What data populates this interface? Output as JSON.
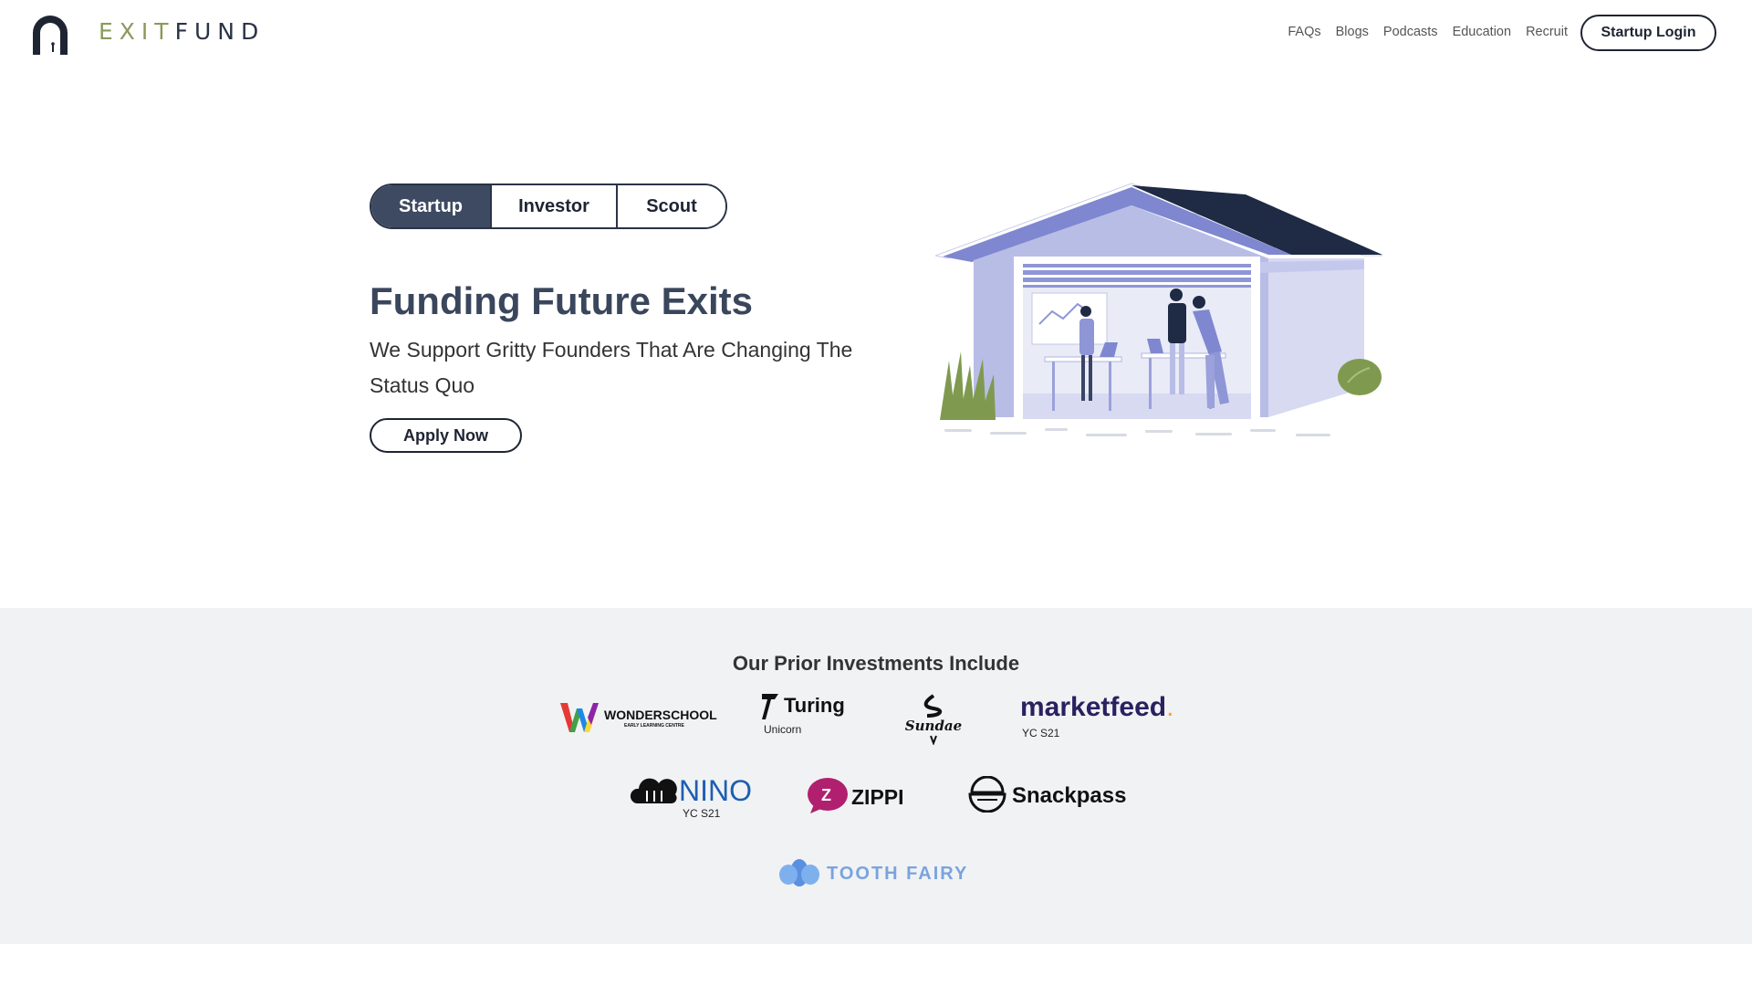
{
  "brand": {
    "name_part1": "EXIT",
    "name_part2": "FUND",
    "mark_icon": "arch-keyhole-icon"
  },
  "nav": {
    "items": [
      "FAQs",
      "Blogs",
      "Podcasts",
      "Education",
      "Recruit"
    ],
    "login_label": "Startup Login"
  },
  "hero": {
    "tabs": [
      {
        "label": "Startup",
        "active": true
      },
      {
        "label": "Investor",
        "active": false
      },
      {
        "label": "Scout",
        "active": false
      }
    ],
    "title": "Funding Future Exits",
    "subtitle": "We Support Gritty Founders That Are Changing The Status Quo",
    "cta_label": "Apply Now",
    "illustration_icon": "startup-garage-illustration"
  },
  "investments": {
    "title": "Our Prior Investments Include",
    "logos": [
      {
        "name": "WONDERSCHOOL",
        "tagline": "EARLY LEARNING CENTRE",
        "caption": ""
      },
      {
        "name": "Turing",
        "tagline": "",
        "caption": "Unicorn"
      },
      {
        "name": "Sundae",
        "tagline": "",
        "caption": ""
      },
      {
        "name": "marketfeed",
        "tagline": "",
        "caption": "YC S21"
      },
      {
        "name": "NINO",
        "tagline": "",
        "caption": "YC S21"
      },
      {
        "name": "ZIPPI",
        "tagline": "",
        "caption": ""
      },
      {
        "name": "Snackpass",
        "tagline": "",
        "caption": ""
      },
      {
        "name": "TOOTH FAIRY",
        "tagline": "",
        "caption": ""
      }
    ]
  },
  "colors": {
    "accent_dark": "#3e4a62",
    "brand_olive": "#8a9a5b",
    "illustration_blue": "#7e87cf",
    "section_bg": "#f1f2f4"
  }
}
